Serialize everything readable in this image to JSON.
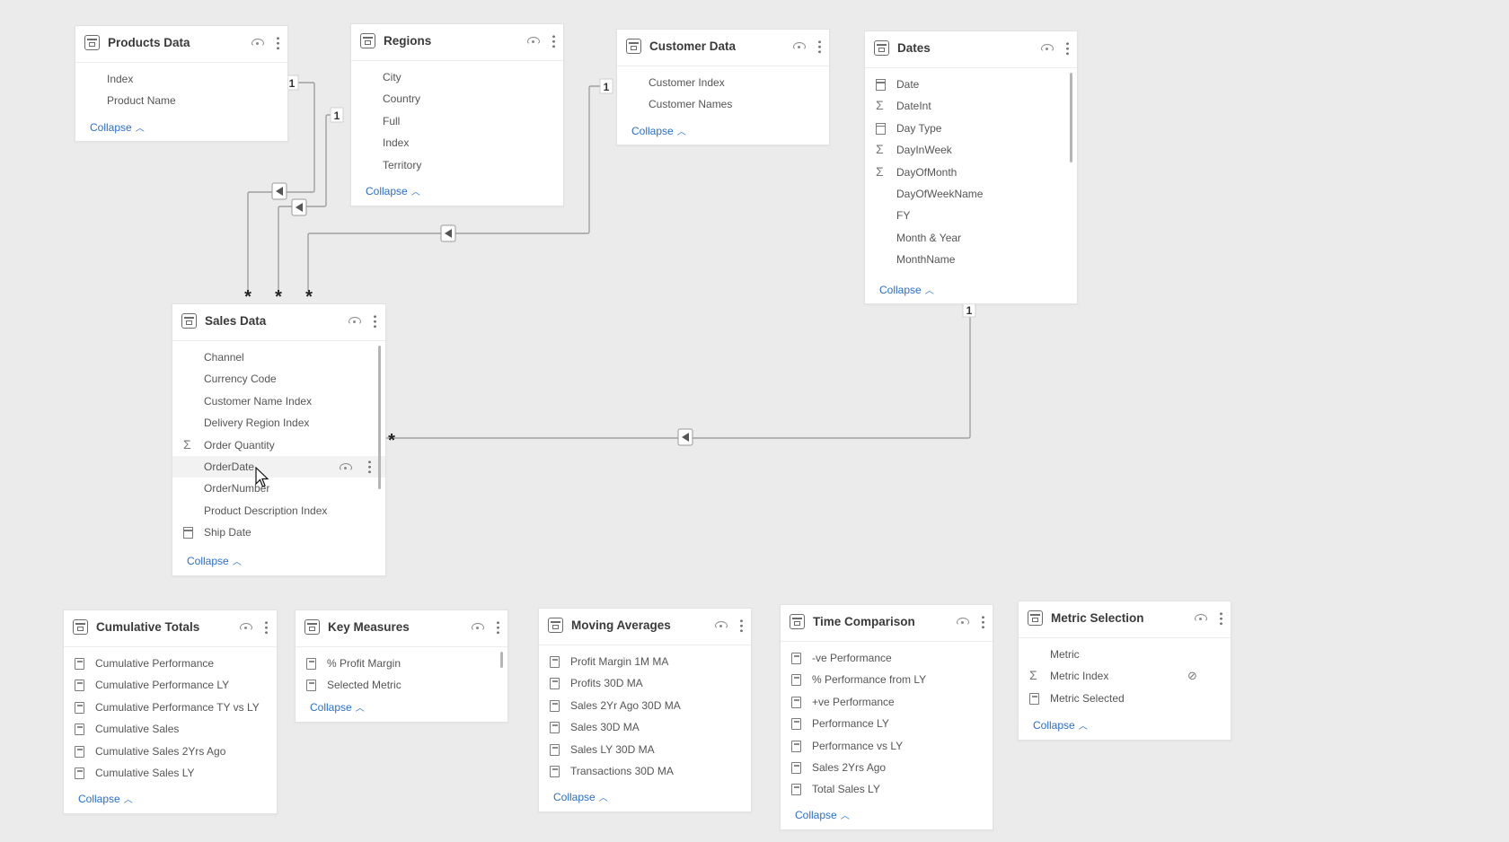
{
  "relationships": {
    "one_label": "1",
    "many_label": "*"
  },
  "tables": {
    "products": {
      "title": "Products Data",
      "fields": [
        {
          "name": "Index",
          "icon": "none"
        },
        {
          "name": "Product Name",
          "icon": "none"
        }
      ],
      "collapse": "Collapse"
    },
    "regions": {
      "title": "Regions",
      "fields": [
        {
          "name": "City",
          "icon": "none"
        },
        {
          "name": "Country",
          "icon": "none"
        },
        {
          "name": "Full",
          "icon": "none"
        },
        {
          "name": "Index",
          "icon": "none"
        },
        {
          "name": "Territory",
          "icon": "none"
        }
      ],
      "collapse": "Collapse"
    },
    "customer": {
      "title": "Customer Data",
      "fields": [
        {
          "name": "Customer Index",
          "icon": "none"
        },
        {
          "name": "Customer Names",
          "icon": "none"
        }
      ],
      "collapse": "Collapse"
    },
    "dates": {
      "title": "Dates",
      "fields": [
        {
          "name": "Date",
          "icon": "calendar-icon"
        },
        {
          "name": "DateInt",
          "icon": "sigma-icon"
        },
        {
          "name": "Day Type",
          "icon": "calendar-icon"
        },
        {
          "name": "DayInWeek",
          "icon": "sigma-icon"
        },
        {
          "name": "DayOfMonth",
          "icon": "sigma-icon"
        },
        {
          "name": "DayOfWeekName",
          "icon": "none"
        },
        {
          "name": "FY",
          "icon": "none"
        },
        {
          "name": "Month & Year",
          "icon": "none"
        },
        {
          "name": "MonthName",
          "icon": "none"
        }
      ],
      "collapse": "Collapse"
    },
    "sales": {
      "title": "Sales Data",
      "fields": [
        {
          "name": "Channel",
          "icon": "none"
        },
        {
          "name": "Currency Code",
          "icon": "none"
        },
        {
          "name": "Customer Name Index",
          "icon": "none"
        },
        {
          "name": "Delivery Region Index",
          "icon": "none"
        },
        {
          "name": "Order Quantity",
          "icon": "sigma-icon"
        },
        {
          "name": "OrderDate",
          "icon": "none"
        },
        {
          "name": "OrderNumber",
          "icon": "none"
        },
        {
          "name": "Product Description Index",
          "icon": "none"
        },
        {
          "name": "Ship Date",
          "icon": "calendar-icon"
        }
      ],
      "collapse": "Collapse"
    },
    "cumulative": {
      "title": "Cumulative Totals",
      "fields": [
        {
          "name": "Cumulative Performance",
          "icon": "measure-icon"
        },
        {
          "name": "Cumulative Performance LY",
          "icon": "measure-icon"
        },
        {
          "name": "Cumulative Performance TY vs LY",
          "icon": "measure-icon"
        },
        {
          "name": "Cumulative Sales",
          "icon": "measure-icon"
        },
        {
          "name": "Cumulative Sales 2Yrs Ago",
          "icon": "measure-icon"
        },
        {
          "name": "Cumulative Sales LY",
          "icon": "measure-icon"
        }
      ],
      "collapse": "Collapse"
    },
    "key": {
      "title": "Key Measures",
      "fields": [
        {
          "name": "% Profit Margin",
          "icon": "measure-icon"
        },
        {
          "name": "Selected Metric",
          "icon": "measure-icon"
        }
      ],
      "collapse": "Collapse"
    },
    "moving": {
      "title": "Moving Averages",
      "fields": [
        {
          "name": "Profit Margin 1M MA",
          "icon": "measure-icon"
        },
        {
          "name": "Profits 30D MA",
          "icon": "measure-icon"
        },
        {
          "name": "Sales 2Yr Ago 30D MA",
          "icon": "measure-icon"
        },
        {
          "name": "Sales 30D MA",
          "icon": "measure-icon"
        },
        {
          "name": "Sales LY 30D MA",
          "icon": "measure-icon"
        },
        {
          "name": "Transactions 30D MA",
          "icon": "measure-icon"
        }
      ],
      "collapse": "Collapse"
    },
    "time": {
      "title": "Time Comparison",
      "fields": [
        {
          "name": "-ve Performance",
          "icon": "measure-icon"
        },
        {
          "name": "% Performance from LY",
          "icon": "measure-icon"
        },
        {
          "name": "+ve Performance",
          "icon": "measure-icon"
        },
        {
          "name": "Performance LY",
          "icon": "measure-icon"
        },
        {
          "name": "Performance vs LY",
          "icon": "measure-icon"
        },
        {
          "name": "Sales 2Yrs Ago",
          "icon": "measure-icon"
        },
        {
          "name": "Total Sales LY",
          "icon": "measure-icon"
        }
      ],
      "collapse": "Collapse"
    },
    "metric": {
      "title": "Metric Selection",
      "fields": [
        {
          "name": "Metric",
          "icon": "none"
        },
        {
          "name": "Metric Index",
          "icon": "sigma-icon"
        },
        {
          "name": "Metric Selected",
          "icon": "measure-icon"
        }
      ],
      "collapse": "Collapse"
    }
  },
  "colors": {
    "canvas": "#ebebeb",
    "link": "#2b6fc7",
    "line": "#9a9a9a"
  }
}
